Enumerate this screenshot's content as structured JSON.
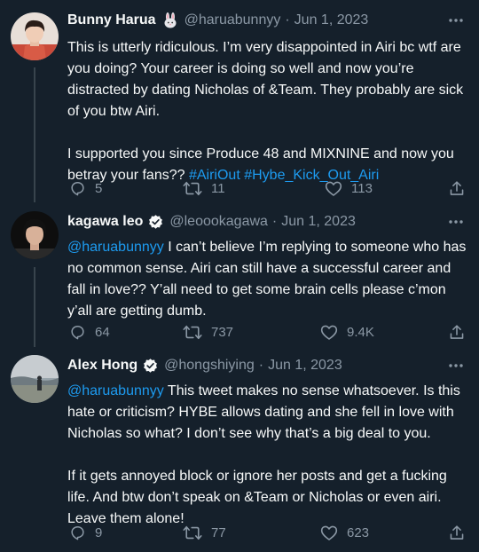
{
  "tweets": [
    {
      "name": "Bunny Harua",
      "name_badge_icon": "rabbit-emoji-icon",
      "handle": "@haruabunnyy",
      "separator": "·",
      "date": "Jun 1, 2023",
      "verified": false,
      "paragraphs": [
        [
          {
            "text": "This is utterly ridiculous. I’m very disappointed in Airi bc wtf are you doing? Your career is doing so well and now you’re distracted by dating Nicholas of &Team. They probably are sick of you btw Airi."
          }
        ],
        [
          {
            "text": "I supported you since Produce 48 and MIXNINE and now you betray your fans?? "
          },
          {
            "text": "#AiriOut",
            "link": true
          },
          {
            "text": " "
          },
          {
            "text": "#Hybe_Kick_Out_Airi",
            "link": true
          }
        ]
      ],
      "replies": "5",
      "retweets": "11",
      "likes": "113"
    },
    {
      "name": "kagawa leo",
      "handle": "@leoookagawa",
      "separator": "·",
      "date": "Jun 1, 2023",
      "verified": true,
      "paragraphs": [
        [
          {
            "text": "@haruabunnyy",
            "link": true
          },
          {
            "text": " I can’t believe I’m replying to someone who has no common sense. Airi can still have a successful career and fall in love?? Y’all need to get some brain cells please c’mon y’all are getting dumb."
          }
        ]
      ],
      "replies": "64",
      "retweets": "737",
      "likes": "9.4K"
    },
    {
      "name": "Alex Hong",
      "handle": "@hongshiying",
      "separator": "·",
      "date": "Jun 1, 2023",
      "verified": true,
      "paragraphs": [
        [
          {
            "text": "@haruabunnyy",
            "link": true
          },
          {
            "text": " This tweet makes no sense whatsoever. Is this hate or criticism? HYBE allows dating and she fell in love with Nicholas so what? I don’t see why that’s a big deal to you."
          }
        ],
        [
          {
            "text": "If it gets annoyed block or ignore her posts and get a fucking life. And btw don’t speak on &Team or Nicholas or even airi. Leave them alone!"
          }
        ]
      ],
      "replies": "9",
      "retweets": "77",
      "likes": "623"
    }
  ],
  "colors": {
    "background": "#15202b",
    "text": "#f7f9f9",
    "secondary": "#8b98a5",
    "link": "#1d9bf0",
    "thread_line": "#38444d"
  }
}
